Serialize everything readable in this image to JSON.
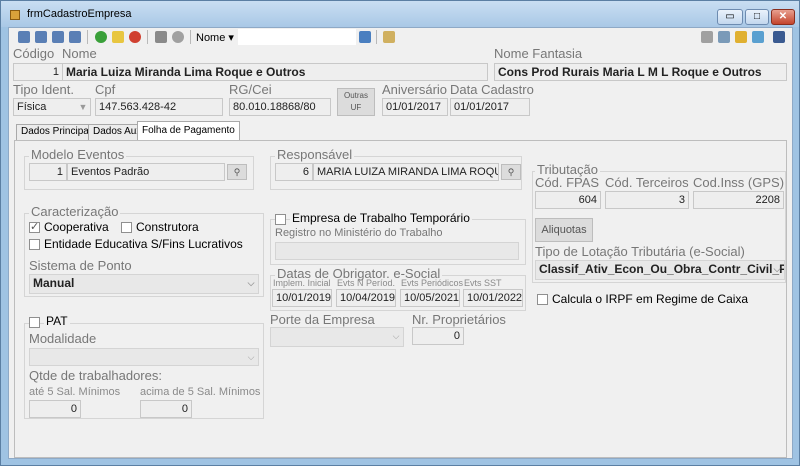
{
  "window": {
    "title": "frmCadastroEmpresa",
    "min": "▭",
    "max": "□",
    "close": "✕"
  },
  "toolbar": {
    "search_label": "Nome ▾",
    "search_value": ""
  },
  "header": {
    "codigo_label": "Código",
    "codigo_value": "1",
    "nome_label": "Nome",
    "nome_value": "Maria Luiza Miranda Lima Roque e Outros",
    "fantasia_label": "Nome Fantasia",
    "fantasia_value": "Cons Prod Rurais Maria L M L Roque e Outros",
    "tipo_label": "Tipo Ident.",
    "tipo_value": "Física",
    "cpf_label": "Cpf",
    "cpf_value": "147.563.428-42",
    "rg_label": "RG/Cei",
    "rg_value": "80.010.18868/80",
    "outras_uf_label": "Outras UF",
    "aniversario_label": "Aniversário",
    "aniversario_value": "01/01/2017",
    "data_cadastro_label": "Data Cadastro",
    "data_cadastro_value": "01/01/2017"
  },
  "tabs": [
    "Dados Principais",
    "Dados Aux.",
    "Folha de Pagamento"
  ],
  "folha": {
    "modelo_label": "Modelo Eventos",
    "modelo_code": "1",
    "modelo_value": "Eventos Padrão",
    "responsavel_label": "Responsável",
    "responsavel_code": "6",
    "responsavel_value": "MARIA LUIZA MIRANDA LIMA ROQUE",
    "tributacao_label": "Tributação",
    "fpas_label": "Cód. FPAS",
    "fpas_value": "604",
    "terceiros_label": "Cód. Terceiros",
    "terceiros_value": "3",
    "inss_label": "Cod.Inss (GPS)",
    "inss_value": "2208",
    "aliquotas_button": "Aliquotas",
    "lotacao_label": "Tipo de Lotação Tributária (e-Social)",
    "lotacao_value": "Classif_Ativ_Econ_Ou_Obra_Contr_Civil_P",
    "calcula_irpf_label": "Calcula o IRPF em Regime de Caixa",
    "caracterizacao_label": "Caracterização",
    "cooperativa_label": "Cooperativa",
    "construtora_label": "Construtora",
    "entidade_label": "Entidade Educativa S/Fins Lucrativos",
    "sistema_ponto_label": "Sistema de Ponto",
    "sistema_ponto_value": "Manual",
    "empresa_temp_label": "Empresa de Trabalho Temporário",
    "registro_label": "Registro no Ministério do Trabalho",
    "registro_value": "",
    "datas_label": "Datas de Obrigator. e-Social",
    "implem_label": "Implem. Inicial",
    "implem_value": "10/01/2019",
    "evts_nper_label": "Evts N Períod.",
    "evts_nper_value": "10/04/2019",
    "evts_per_label": "Evts Periódicos",
    "evts_per_value": "10/05/2021",
    "evts_sst_label": "Evts SST",
    "evts_sst_value": "10/01/2022",
    "pat_label": "PAT",
    "modalidade_label": "Modalidade",
    "modalidade_value": "",
    "qtde_label": "Qtde de trabalhadores:",
    "ate5_label": "até 5 Sal. Mínimos",
    "ate5_value": "0",
    "acima5_label": "acima de 5 Sal. Mínimos",
    "acima5_value": "0",
    "porte_label": "Porte da Empresa",
    "porte_value": "",
    "nr_prop_label": "Nr. Proprietários",
    "nr_prop_value": "0"
  }
}
